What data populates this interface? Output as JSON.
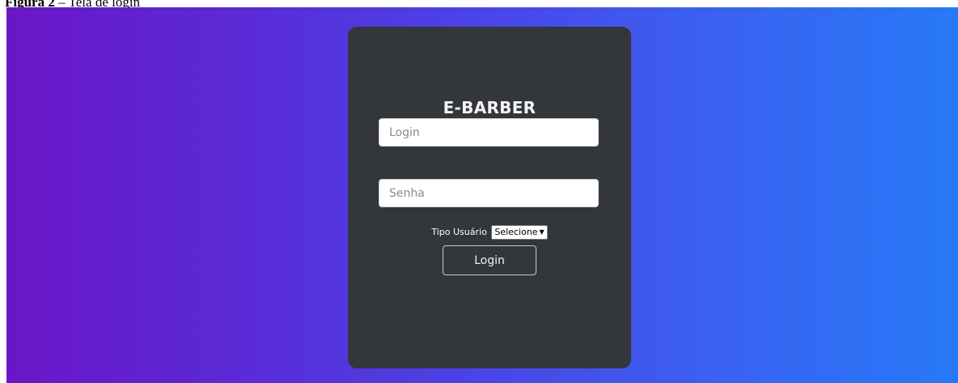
{
  "caption": {
    "lead": "Figura 2",
    "rest": " – Tela de login"
  },
  "card": {
    "title": "E-BARBER",
    "login_placeholder": "Login",
    "password_placeholder": "Senha",
    "user_type_label": "Tipo Usuário",
    "user_type_selected": "Selecione",
    "login_button": "Login"
  },
  "colors": {
    "gradient_start": "#6a16c6",
    "gradient_end": "#2779f8",
    "card_background": "#33363b"
  },
  "icons": {
    "select_chevron": "chevron-down-icon"
  }
}
